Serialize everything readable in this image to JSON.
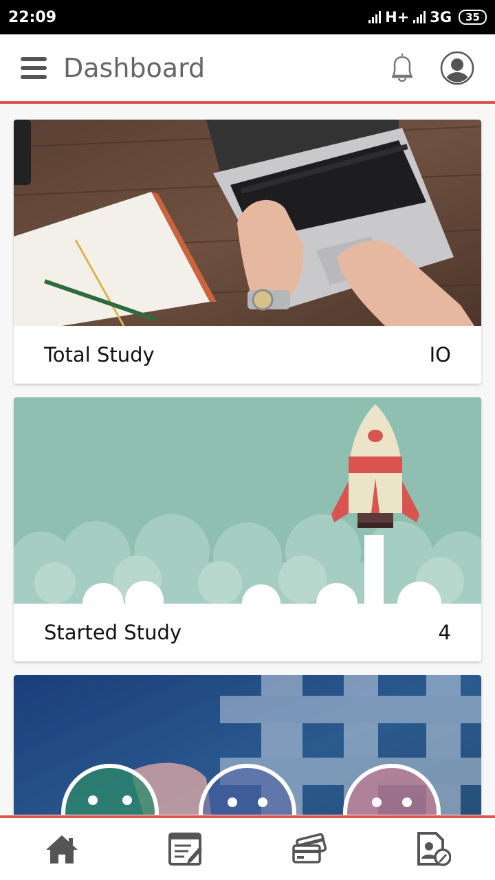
{
  "status_bar": {
    "time": "22:09",
    "network_1": "H+",
    "network_2": "3G",
    "battery": "35"
  },
  "header": {
    "title": "Dashboard",
    "icons": [
      "menu-icon",
      "bell-icon",
      "avatar-icon"
    ]
  },
  "cards": [
    {
      "label": "Total Study",
      "value": "IO",
      "image": "laptop-desk-photo"
    },
    {
      "label": "Started Study",
      "value": "4",
      "image": "rocket-launch-illustration"
    },
    {
      "label": "",
      "value": "",
      "image": "feedback-smileys-photo"
    }
  ],
  "bottom_nav": {
    "items": [
      "home-icon",
      "notepad-edit-icon",
      "cards-payment-icon",
      "profile-edit-icon"
    ]
  },
  "colors": {
    "accent": "#e05350",
    "icon_gray": "#555555",
    "rocket_bg": "#8fbfb0"
  }
}
